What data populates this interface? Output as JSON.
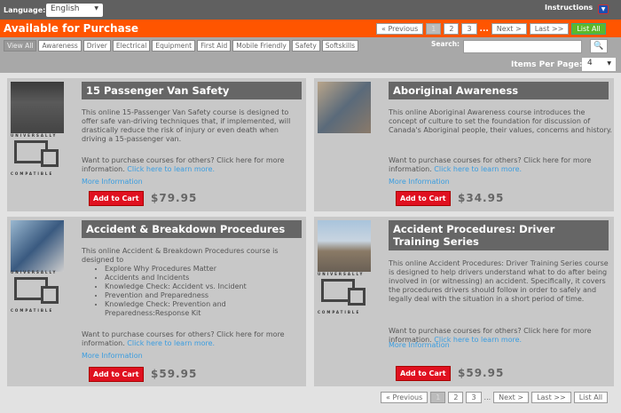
{
  "header": {
    "language_label": "Language:",
    "language_value": "English",
    "instructions": "Instructions"
  },
  "title": "Available for Purchase",
  "pagination": {
    "previous": "« Previous",
    "pages": [
      "1",
      "2",
      "3"
    ],
    "ellipsis": "...",
    "next": "Next >",
    "last": "Last >>",
    "list_all": "List All"
  },
  "categories": [
    "View All",
    "Awareness",
    "Driver",
    "Electrical",
    "Equipment",
    "First Aid",
    "Mobile Friendly",
    "Safety",
    "Softskills"
  ],
  "search": {
    "label": "Search:",
    "value": ""
  },
  "items_per_page": {
    "label": "Items Per Page:",
    "value": "4"
  },
  "badge": {
    "top": "UNIVERSALLY",
    "bottom": "COMPATIBLE"
  },
  "courses": [
    {
      "title": "15 Passenger Van Safety",
      "description": "This online 15-Passenger Van Safety course is designed to offer safe van-driving techniques that, if implemented, will drastically reduce the risk of injury or even death when driving a 15-passenger van.",
      "purchase_text": "Want to purchase courses for others? Click here for more information.",
      "purchase_link": "Click here to learn more.",
      "more_info": "More Information",
      "cart": "Add to Cart",
      "price": "$79.95"
    },
    {
      "title": "Aboriginal Awareness",
      "description": "This online Aboriginal Awareness course introduces the concept of culture to set the foundation for discussion of Canada's Aboriginal people, their values, concerns and history.",
      "purchase_text": "Want to purchase courses for others? Click here for more information.",
      "purchase_link": "Click here to learn more.",
      "more_info": "More Information",
      "cart": "Add to Cart",
      "price": "$34.95"
    },
    {
      "title": "Accident & Breakdown Procedures",
      "description": "This online Accident & Breakdown Procedures course is designed to",
      "bullets": [
        "Explore Why Procedures Matter",
        "Accidents and Incidents",
        "Knowledge Check: Accident vs. Incident",
        "Prevention and Preparedness",
        "Knowledge Check: Prevention and Preparedness:Response Kit"
      ],
      "purchase_text": "Want to purchase courses for others? Click here for more information.",
      "purchase_link": "Click here to learn more.",
      "more_info": "More Information",
      "cart": "Add to Cart",
      "price": "$59.95"
    },
    {
      "title": "Accident Procedures: Driver Training Series",
      "description": "This online Accident Procedures: Driver Training Series course is designed to help drivers understand what to do after being involved in (or witnessing) an accident. Specifically, it covers the procedures drivers should follow in order to safely and legally deal with the situation in a short period of time.",
      "purchase_text": "Want to purchase courses for others? Click here for more information.",
      "purchase_link": "Click here to learn more.",
      "more_info": "More Information",
      "cart": "Add to Cart",
      "price": "$59.95"
    }
  ]
}
